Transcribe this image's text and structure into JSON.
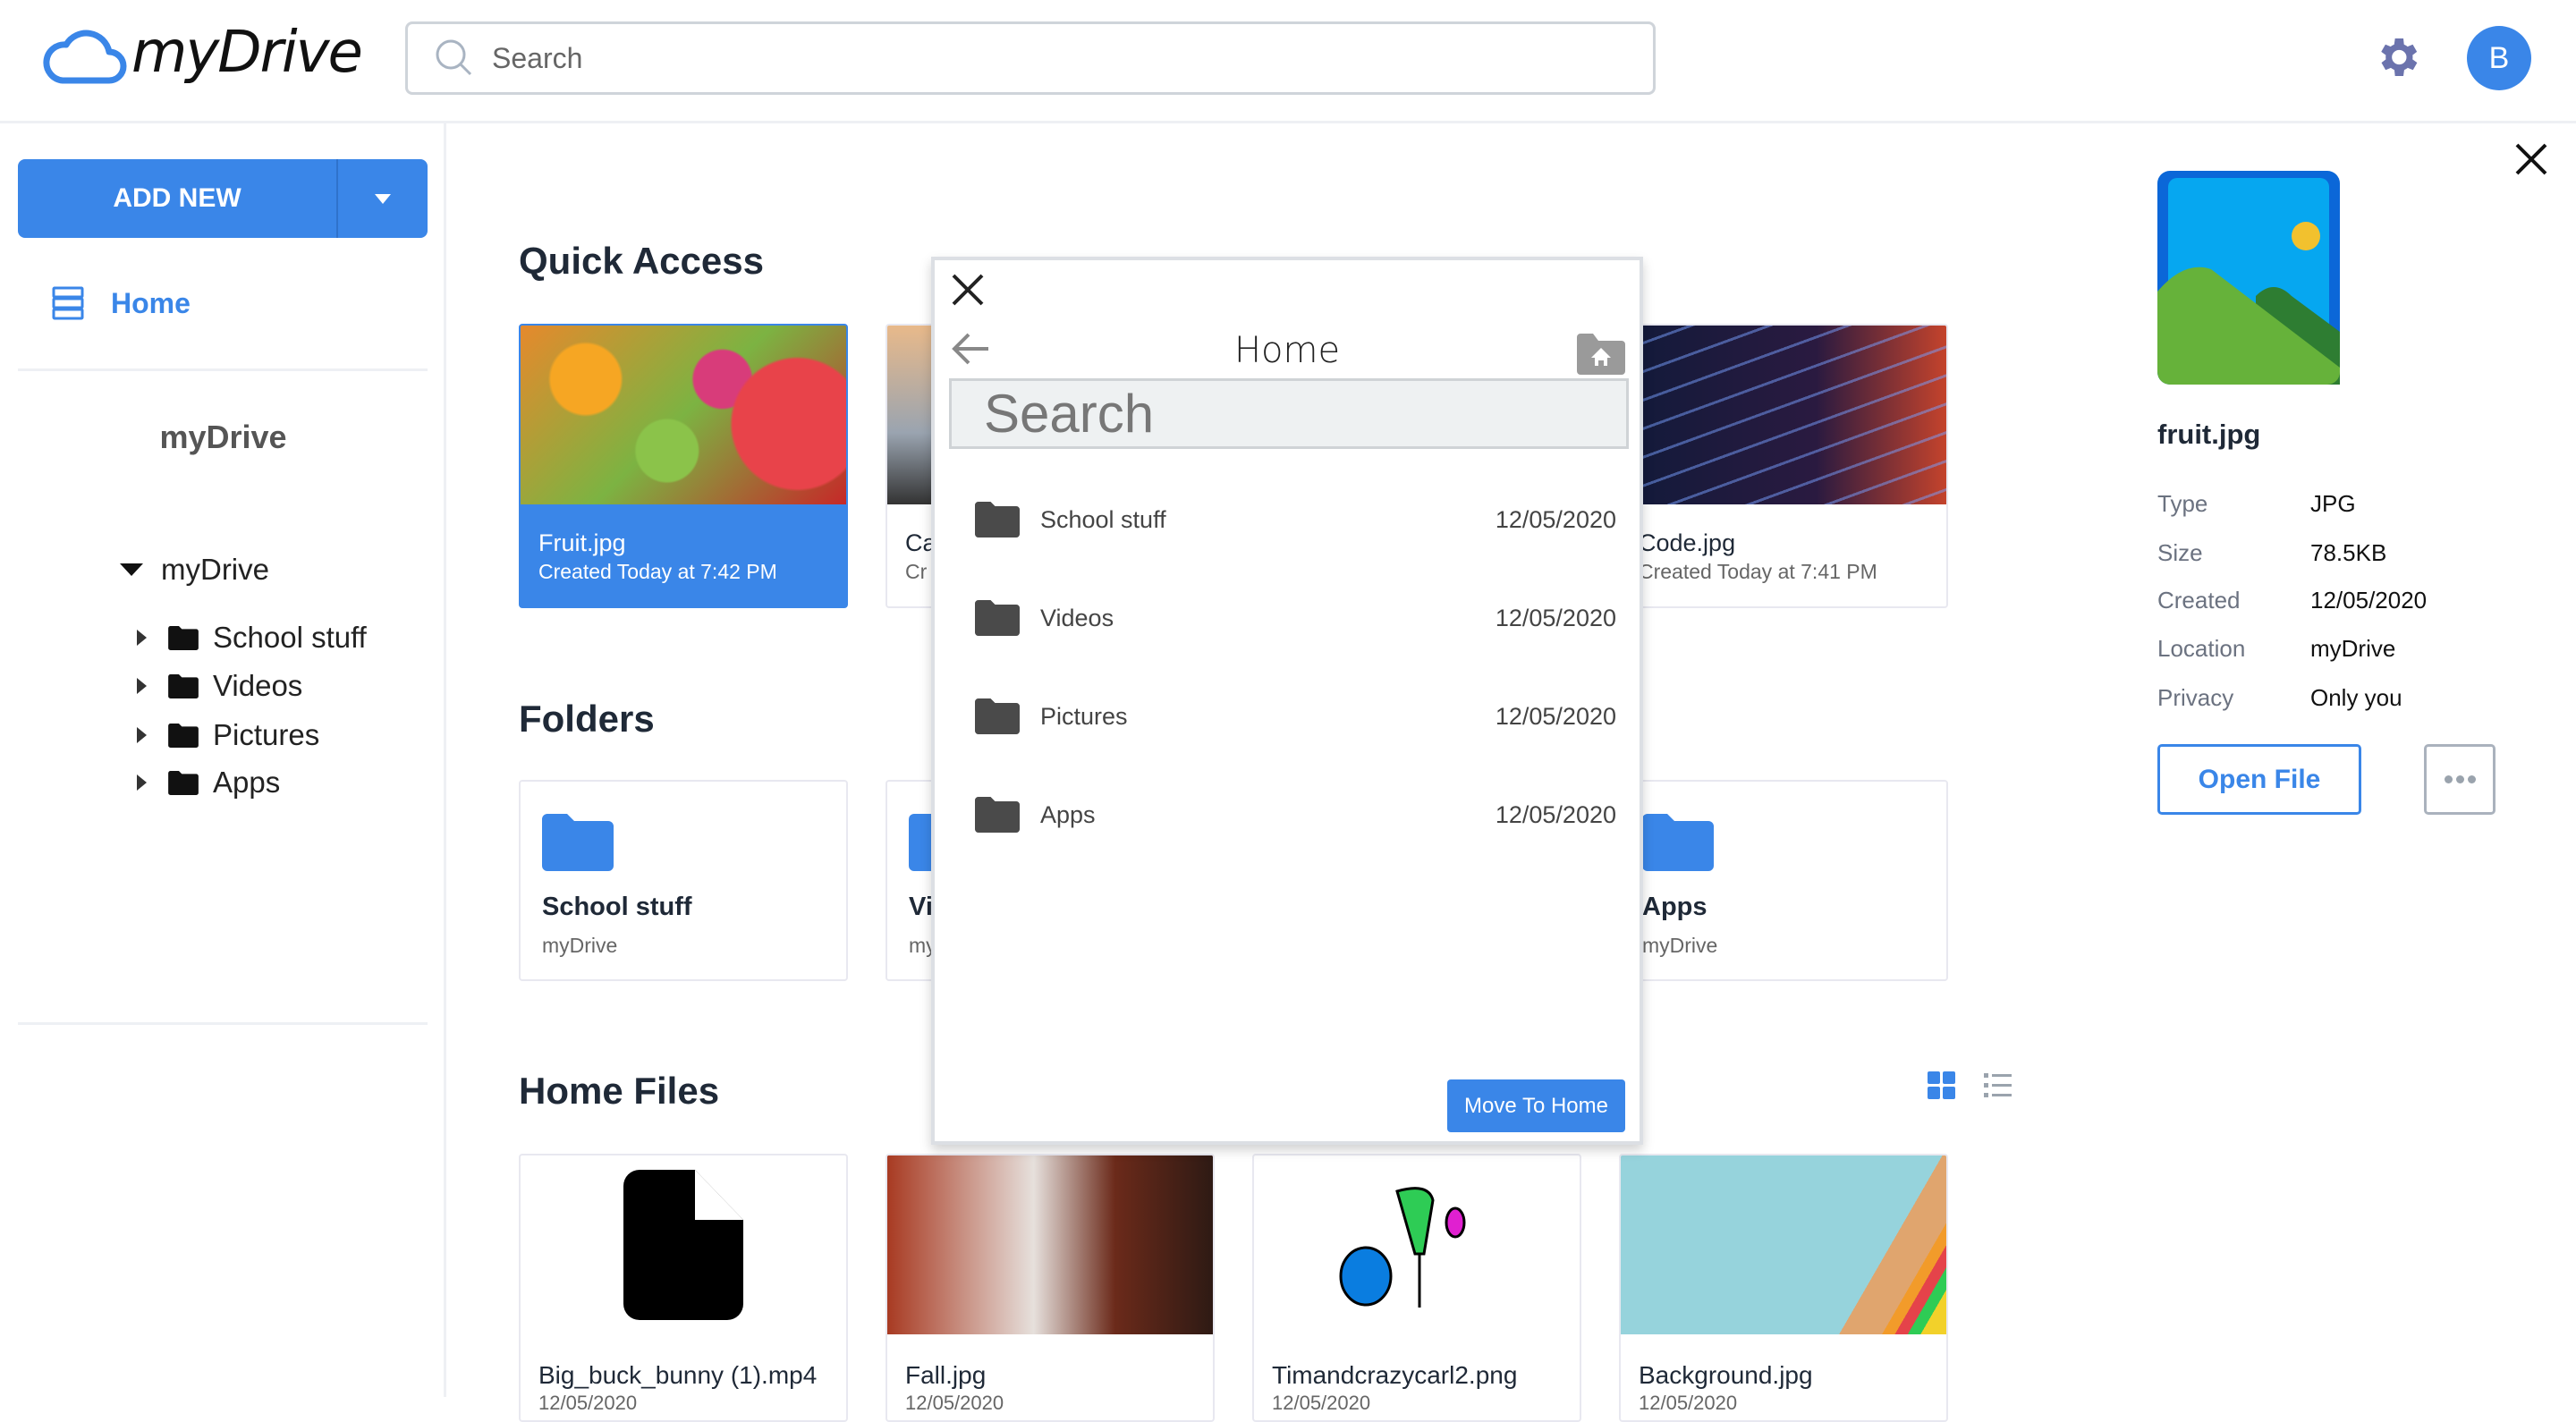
{
  "header": {
    "logo_text": "myDrive",
    "search_placeholder": "Search",
    "avatar_initial": "B",
    "brand_color": "#3a86e8"
  },
  "sidebar": {
    "add_new_label": "ADD NEW",
    "home_label": "Home",
    "title": "myDrive",
    "tree_root": "myDrive",
    "tree_items": [
      {
        "label": "School stuff"
      },
      {
        "label": "Videos"
      },
      {
        "label": "Pictures"
      },
      {
        "label": "Apps"
      }
    ]
  },
  "main": {
    "quick_access_title": "Quick Access",
    "quick_access": [
      {
        "name": "Fruit.jpg",
        "sub": "Created Today at 7:42 PM",
        "selected": true
      },
      {
        "name": "Ca",
        "sub": "Cr"
      },
      {
        "name": "",
        "sub": ""
      },
      {
        "name": "Code.jpg",
        "sub": "Created Today at 7:41 PM"
      }
    ],
    "folders_title": "Folders",
    "folders": [
      {
        "name": "School stuff",
        "sub": "myDrive"
      },
      {
        "name": "Vi",
        "sub": "my"
      },
      {
        "name": "",
        "sub": ""
      },
      {
        "name": "Apps",
        "sub": "myDrive"
      }
    ],
    "home_files_title": "Home Files",
    "view_mode": "grid",
    "home_files": [
      {
        "name": "Big_buck_bunny (1).mp4",
        "sub": "12/05/2020"
      },
      {
        "name": "Fall.jpg",
        "sub": "12/05/2020"
      },
      {
        "name": "Timandcrazycarl2.png",
        "sub": "12/05/2020"
      },
      {
        "name": "Background.jpg",
        "sub": "12/05/2020"
      }
    ]
  },
  "details": {
    "file_name": "fruit.jpg",
    "props": [
      {
        "key": "Type",
        "value": "JPG"
      },
      {
        "key": "Size",
        "value": "78.5KB"
      },
      {
        "key": "Created",
        "value": "12/05/2020"
      },
      {
        "key": "Location",
        "value": "myDrive"
      },
      {
        "key": "Privacy",
        "value": "Only you"
      }
    ],
    "open_label": "Open File"
  },
  "move_modal": {
    "title": "Home",
    "search_placeholder": "Search",
    "rows": [
      {
        "name": "School stuff",
        "date": "12/05/2020"
      },
      {
        "name": "Videos",
        "date": "12/05/2020"
      },
      {
        "name": "Pictures",
        "date": "12/05/2020"
      },
      {
        "name": "Apps",
        "date": "12/05/2020"
      }
    ],
    "move_label": "Move To Home"
  }
}
